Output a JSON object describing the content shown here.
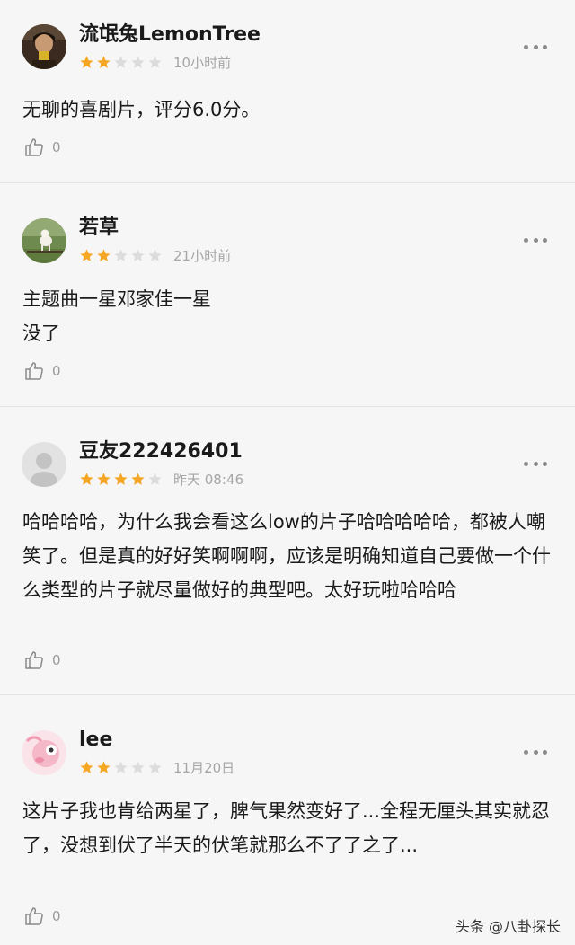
{
  "reviews": [
    {
      "username": "流氓兔LemonTree",
      "rating": 2,
      "time": "10小时前",
      "content": "无聊的喜剧片，评分6.0分。",
      "likes": "0",
      "avatar": "photo"
    },
    {
      "username": "若草",
      "rating": 2,
      "time": "21小时前",
      "content": "主题曲一星邓家佳一星\n没了",
      "likes": "0",
      "avatar": "dog-photo"
    },
    {
      "username": "豆友222426401",
      "rating": 4,
      "time": "昨天 08:46",
      "content": "哈哈哈哈，为什么我会看这么low的片子哈哈哈哈哈，都被人嘲笑了。但是真的好好笑啊啊啊，应该是明确知道自己要做一个什么类型的片子就尽量做好的典型吧。太好玩啦哈哈哈",
      "likes": "0",
      "avatar": "default-person"
    },
    {
      "username": "lee",
      "rating": 2,
      "time": "11月20日",
      "content": "这片子我也肯给两星了，脾气果然变好了...全程无厘头其实就忍了，没想到伏了半天的伏笔就那么不了了之了...",
      "likes": "0",
      "avatar": "pink-cartoon"
    }
  ],
  "icons": {
    "star_filled": "star-filled-icon",
    "star_empty": "star-empty-icon",
    "more": "more-icon",
    "like": "thumbs-up-icon"
  },
  "colors": {
    "star_filled": "#f5a623",
    "star_empty": "#dcdcdc",
    "background": "#f6f6f6",
    "divider": "#e4e4e4"
  },
  "watermark": "头条 @八卦探长"
}
